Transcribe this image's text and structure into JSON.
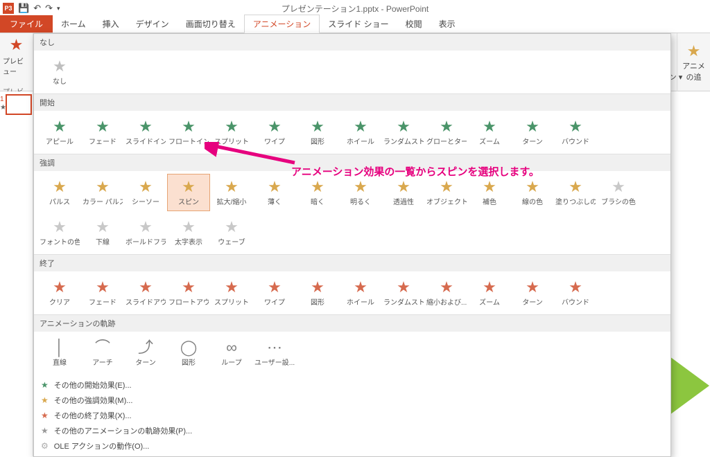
{
  "title": "プレゼンテーション1.pptx - PowerPoint",
  "app_icon": "P3",
  "tabs": {
    "file": "ファイル",
    "home": "ホーム",
    "insert": "挿入",
    "design": "デザイン",
    "trans": "画面切り替え",
    "anim": "アニメーション",
    "slideshow": "スライド ショー",
    "review": "校閲",
    "view": "表示"
  },
  "preview": {
    "label": "プレビュー",
    "sub": "プレビュー"
  },
  "effect_opts": "効果の\nオプション ▾",
  "anim_add": "アニメ\nの追",
  "sections": {
    "none": "なし",
    "entrance": "開始",
    "emphasis": "強調",
    "exit": "終了",
    "path": "アニメーションの軌跡"
  },
  "none_item": "なし",
  "entrance": [
    "アピール",
    "フェード",
    "スライドイン",
    "フロートイン",
    "スプリット",
    "ワイプ",
    "図形",
    "ホイール",
    "ランダムスト...",
    "グローとターン",
    "ズーム",
    "ターン",
    "バウンド"
  ],
  "emphasis1": [
    "パルス",
    "カラー パルス",
    "シーソー",
    "スピン",
    "拡大/縮小",
    "薄く",
    "暗く",
    "明るく",
    "透過性",
    "オブジェクト ...",
    "補色",
    "線の色",
    "塗りつぶしの色",
    "ブラシの色"
  ],
  "emphasis2": [
    "フォントの色",
    "下線",
    "ボールドフラ...",
    "太字表示",
    "ウェーブ"
  ],
  "exit": [
    "クリア",
    "フェード",
    "スライドアウト",
    "フロートアウト",
    "スプリット",
    "ワイプ",
    "図形",
    "ホイール",
    "ランダムスト...",
    "縮小および...",
    "ズーム",
    "ターン",
    "バウンド"
  ],
  "path": [
    "直線",
    "アーチ",
    "ターン",
    "図形",
    "ループ",
    "ユーザー設..."
  ],
  "more": [
    {
      "c": "ms-entrance",
      "t": "その他の開始効果(E)..."
    },
    {
      "c": "ms-emph",
      "t": "その他の強調効果(M)..."
    },
    {
      "c": "ms-exit",
      "t": "その他の終了効果(X)..."
    },
    {
      "c": "ms-path",
      "t": "その他のアニメーションの軌跡効果(P)..."
    },
    {
      "c": "ms-ole",
      "t": "OLE アクションの動作(O)..."
    }
  ],
  "annotation": "アニメーション効果の一覧からスピンを選択します。",
  "selected": "スピン",
  "thumb_num": "1"
}
